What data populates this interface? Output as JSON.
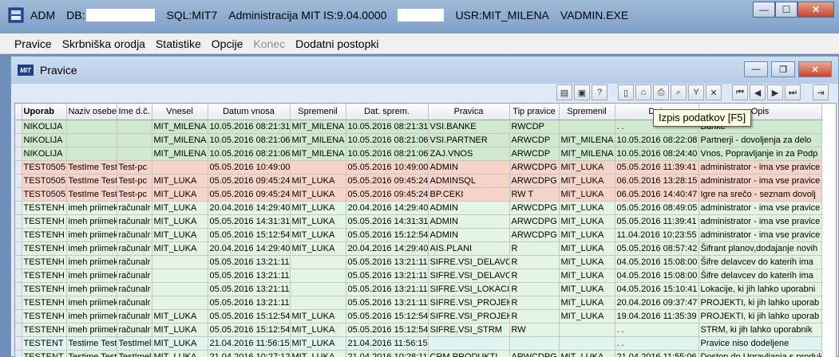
{
  "titlebar": {
    "app": "ADM",
    "db_label": "DB:",
    "sql": "SQL:MIT7",
    "admin": "Administracija MIT IS:9.04.0000",
    "usr": "USR:MIT_MILENA",
    "exe": "VADMIN.EXE",
    "minimize": "—",
    "maximize": "☐",
    "close": "✕"
  },
  "menu": [
    "Pravice",
    "Skrbniška orodja",
    "Statistike",
    "Opcije",
    "Konec",
    "Dodatni postopki"
  ],
  "child": {
    "logo": "MIT",
    "title": "Pravice",
    "minimize": "—",
    "restore": "❐",
    "close": "✕"
  },
  "tooltip": "Izpis podatkov [F5]",
  "columns": [
    "Uporab",
    "Naziv osebe",
    "Ime d.č.",
    "Vnesel",
    "Datum vnosa",
    "Spremenil",
    "Dat. sprem.",
    "Pravica",
    "Tip pravice",
    "Spremenil",
    "Dat.",
    "Opis"
  ],
  "rows": [
    {
      "c": "g",
      "v": [
        "NIKOLIJA",
        "",
        "",
        "MIT_MILENA",
        "10.05.2016 08:21:31",
        "MIT_MILENA",
        "10.05.2016 08:21:31",
        "VSI.BANKE",
        "RWCDP",
        "",
        ". .",
        "Banke"
      ]
    },
    {
      "c": "g",
      "v": [
        "NIKOLIJA",
        "",
        "",
        "MIT_MILENA",
        "10.05.2016 08:21:06",
        "MIT_MILENA",
        "10.05.2016 08:21:06",
        "VSI.PARTNER",
        "ARWCDP",
        "MIT_MILENA",
        "10.05.2016 08:22:08",
        "Partnerji - dovoljenja za delo"
      ]
    },
    {
      "c": "g",
      "v": [
        "NIKOLIJA",
        "",
        "",
        "MIT_MILENA",
        "10.05.2016 08:21:06",
        "MIT_MILENA",
        "10.05.2016 08:21:06",
        "ZAJ.VNOS",
        "ARWCDP",
        "MIT_MILENA",
        "10.05.2016 08:24:40",
        "Vnos, Popravljanje in za Podp"
      ]
    },
    {
      "c": "r",
      "v": [
        "TEST0505",
        "TestIme Test",
        "Test-pc",
        "",
        "05.05.2016 10:49:00",
        "",
        "05.05.2016 10:49:00",
        "ADMIN",
        "ARWCDPG",
        "MIT_LUKA",
        "05.05.2016 11:39:41",
        "administrator - ima vse pravice"
      ]
    },
    {
      "c": "r",
      "v": [
        "TEST0505",
        "TestIme Test",
        "Test-pc",
        "MIT_LUKA",
        "05.05.2016 09:45:24",
        "MIT_LUKA",
        "05.05.2016 09:45:24",
        "ADMINSQL",
        "ARWCDPG",
        "MIT_LUKA",
        "06.05.2016 13:28:15",
        "administrator - ima vse pravice n"
      ]
    },
    {
      "c": "r",
      "v": [
        "TEST0505",
        "TestIme Test",
        "Test-pc",
        "MIT_LUKA",
        "05.05.2016 09:45:24",
        "MIT_LUKA",
        "05.05.2016 09:45:24",
        "BP.CEKI",
        "RW    T",
        "MIT_LUKA",
        "06.05.2016 14:40:47",
        "Igre na srečo - seznam dovolj"
      ]
    },
    {
      "c": "l",
      "v": [
        "TESTENH",
        "imeh priimekh",
        "računalr",
        "MIT_LUKA",
        "20.04.2016 14:29:40",
        "MIT_LUKA",
        "20.04.2016 14:29:40",
        "ADMIN",
        "ARWCDPG",
        "MIT_LUKA",
        "05.05.2016 08:49:05",
        "administrator - ima vse pravice"
      ]
    },
    {
      "c": "l",
      "v": [
        "TESTENH",
        "imeh priimekh",
        "računalr",
        "MIT_LUKA",
        "05.05.2016 14:31:31",
        "MIT_LUKA",
        "05.05.2016 14:31:31",
        "ADMIN",
        "ARWCDPG",
        "MIT_LUKA",
        "05.05.2016 11:39:41",
        "administrator - ima vse pravice"
      ]
    },
    {
      "c": "l",
      "v": [
        "TESTENH",
        "imeh priimekh",
        "računalr",
        "MIT_LUKA",
        "05.05.2016 15:12:54",
        "MIT_LUKA",
        "05.05.2016 15:12:54",
        "ADMIN",
        "ARWCDPG",
        "MIT_LUKA",
        "11.04.2016 10:23:55",
        "administrator - ima vse pravice"
      ]
    },
    {
      "c": "l",
      "v": [
        "TESTENH",
        "imeh priimekh",
        "računalr",
        "MIT_LUKA",
        "20.04.2016 14:29:40",
        "MIT_LUKA",
        "20.04.2016 14:29:40",
        "AIS.PLANI",
        "R",
        "MIT_LUKA",
        "05.05.2016 08:57:42",
        "Šifrant planov,dodajanje novih"
      ]
    },
    {
      "c": "l",
      "v": [
        "TESTENH",
        "imeh priimekh",
        "računalr",
        "",
        "05.05.2016 13:21:11",
        "",
        "05.05.2016 13:21:11",
        "SIFRE.VSI_DELAVC",
        "R",
        "MIT_LUKA",
        "04.05.2016 15:08:00",
        "Šifre delavcev do katerih ima"
      ]
    },
    {
      "c": "l",
      "v": [
        "TESTENH",
        "imeh priimekh",
        "računalr",
        "",
        "05.05.2016 13:21:11",
        "",
        "05.05.2016 13:21:11",
        "SIFRE.VSI_DELAVC",
        "R",
        "MIT_LUKA",
        "04.05.2016 15:08:00",
        "Šifre delavcev do katerih ima"
      ]
    },
    {
      "c": "l",
      "v": [
        "TESTENH",
        "imeh priimekh",
        "računalr",
        "",
        "05.05.2016 13:21:11",
        "",
        "05.05.2016 13:21:11",
        "SIFRE.VSI_LOKACIJ",
        "R",
        "MIT_LUKA",
        "04.05.2016 15:10:41",
        "Lokacije, ki jih lahko uporabni"
      ]
    },
    {
      "c": "l",
      "v": [
        "TESTENH",
        "imeh priimekh",
        "računalr",
        "",
        "05.05.2016 13:21:11",
        "",
        "05.05.2016 13:21:11",
        "SIFRE.VSI_PROJEK",
        "R",
        "MIT_LUKA",
        "20.04.2016 09:37:47",
        "PROJEKTI, ki jih lahko uporab"
      ]
    },
    {
      "c": "l",
      "v": [
        "TESTENH",
        "imeh priimekh",
        "računalr",
        "MIT_LUKA",
        "05.05.2016 15:12:54",
        "MIT_LUKA",
        "05.05.2016 15:12:54",
        "SIFRE.VSI_PROJEK",
        "R",
        "MIT_LUKA",
        "19.04.2016 11:35:39",
        "PROJEKTI, ki jih lahko uporab"
      ]
    },
    {
      "c": "l",
      "v": [
        "TESTENH",
        "imeh priimekh",
        "računalr",
        "MIT_LUKA",
        "05.05.2016 15:12:54",
        "MIT_LUKA",
        "05.05.2016 15:12:54",
        "SIFRE.VSI_STRM",
        "RW",
        "",
        ". .",
        "STRM, ki jih lahko uporabnik"
      ]
    },
    {
      "c": "c",
      "v": [
        "TESTENT",
        "Testime Test",
        "TestImel",
        "MIT_LUKA",
        "21.04.2016 11:56:15",
        "MIT_LUKA",
        "21.04.2016 11:56:15",
        "",
        "",
        "",
        ". .",
        "Pravice niso dodeljene"
      ]
    },
    {
      "c": "l",
      "v": [
        "TESTENT",
        "Testime Test",
        "TestImel",
        "MIT_LUKA",
        "21.04.2016 10:27:12",
        "MIT_LUKA",
        "21.04.2016 10:28:11",
        "CRM.PRODUKTI",
        "ARWCDPG",
        "MIT_LUKA",
        "21.04.2016 11:55:06",
        "Dostop do Upravljanja s produkt"
      ]
    }
  ]
}
